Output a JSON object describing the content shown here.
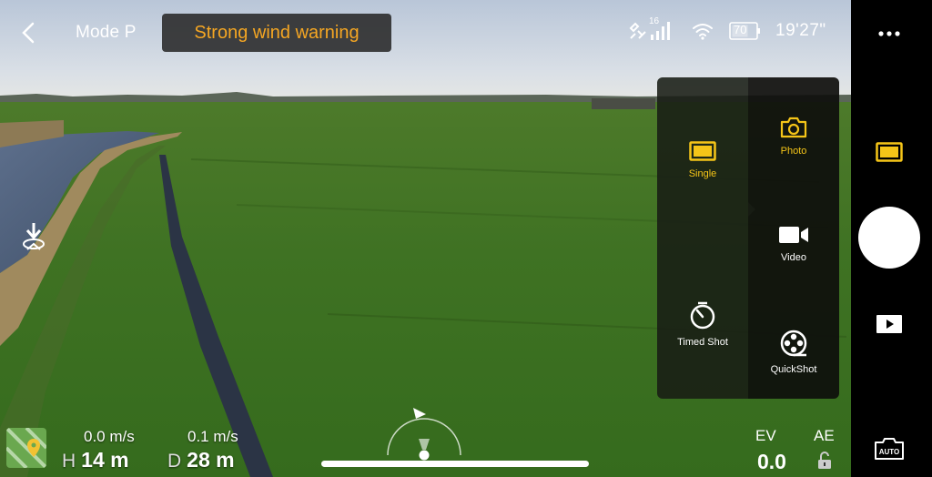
{
  "top_bar": {
    "flight_mode": "Mode P",
    "warning": "Strong wind warning",
    "gps_satellites": "16",
    "battery_percent": "70",
    "time": "19'27\""
  },
  "telemetry": {
    "vertical_speed": "0.0 m/s",
    "height_key": "H",
    "height_value": "14 m",
    "horizontal_speed": "0.1 m/s",
    "distance_key": "D",
    "distance_value": "28 m"
  },
  "exposure": {
    "ev_label": "EV",
    "ev_value": "0.0",
    "ae_label": "AE"
  },
  "mode_panel": {
    "categories": [
      {
        "label": "Photo",
        "icon": "camera-icon",
        "selected": true
      },
      {
        "label": "Video",
        "icon": "video-camera-icon",
        "selected": false
      },
      {
        "label": "QuickShot",
        "icon": "film-reel-icon",
        "selected": false
      }
    ],
    "submodes": [
      {
        "label": "Single",
        "icon": "single-frame-icon",
        "selected": true
      },
      {
        "label": "Timed Shot",
        "icon": "timer-icon",
        "selected": false
      }
    ]
  },
  "colors": {
    "accent": "#f5c518",
    "warning_text": "#f5a623",
    "panel_bg": "#181c14"
  },
  "right_rail": {
    "auto_label": "AUTO"
  }
}
